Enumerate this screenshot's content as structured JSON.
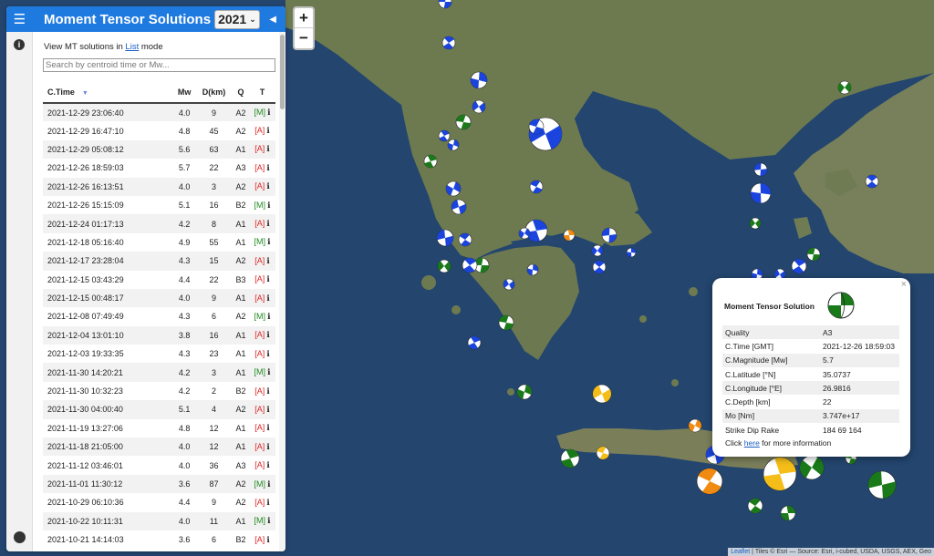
{
  "sidebar": {
    "title": "Moment Tensor Solutions",
    "year": "2021",
    "mode_prefix": "View MT solutions in ",
    "mode_link": "List",
    "mode_suffix": " mode",
    "search_placeholder": "Search by centroid time or Mw...",
    "columns": {
      "time": "C.Time",
      "mw": "Mw",
      "depth": "D(km)",
      "q": "Q",
      "t": "T"
    },
    "rows": [
      {
        "time": "2021-12-29 23:06:40",
        "mw": "4.0",
        "depth": "9",
        "q": "A2",
        "t": "[M]"
      },
      {
        "time": "2021-12-29 16:47:10",
        "mw": "4.8",
        "depth": "45",
        "q": "A2",
        "t": "[A]"
      },
      {
        "time": "2021-12-29 05:08:12",
        "mw": "5.6",
        "depth": "63",
        "q": "A1",
        "t": "[A]"
      },
      {
        "time": "2021-12-26 18:59:03",
        "mw": "5.7",
        "depth": "22",
        "q": "A3",
        "t": "[A]"
      },
      {
        "time": "2021-12-26 16:13:51",
        "mw": "4.0",
        "depth": "3",
        "q": "A2",
        "t": "[A]"
      },
      {
        "time": "2021-12-26 15:15:09",
        "mw": "5.1",
        "depth": "16",
        "q": "B2",
        "t": "[M]"
      },
      {
        "time": "2021-12-24 01:17:13",
        "mw": "4.2",
        "depth": "8",
        "q": "A1",
        "t": "[A]"
      },
      {
        "time": "2021-12-18 05:16:40",
        "mw": "4.9",
        "depth": "55",
        "q": "A1",
        "t": "[M]"
      },
      {
        "time": "2021-12-17 23:28:04",
        "mw": "4.3",
        "depth": "15",
        "q": "A2",
        "t": "[A]"
      },
      {
        "time": "2021-12-15 03:43:29",
        "mw": "4.4",
        "depth": "22",
        "q": "B3",
        "t": "[A]"
      },
      {
        "time": "2021-12-15 00:48:17",
        "mw": "4.0",
        "depth": "9",
        "q": "A1",
        "t": "[A]"
      },
      {
        "time": "2021-12-08 07:49:49",
        "mw": "4.3",
        "depth": "6",
        "q": "A2",
        "t": "[M]"
      },
      {
        "time": "2021-12-04 13:01:10",
        "mw": "3.8",
        "depth": "16",
        "q": "A1",
        "t": "[A]"
      },
      {
        "time": "2021-12-03 19:33:35",
        "mw": "4.3",
        "depth": "23",
        "q": "A1",
        "t": "[A]"
      },
      {
        "time": "2021-11-30 14:20:21",
        "mw": "4.2",
        "depth": "3",
        "q": "A1",
        "t": "[M]"
      },
      {
        "time": "2021-11-30 10:32:23",
        "mw": "4.2",
        "depth": "2",
        "q": "B2",
        "t": "[A]"
      },
      {
        "time": "2021-11-30 04:00:40",
        "mw": "5.1",
        "depth": "4",
        "q": "A2",
        "t": "[A]"
      },
      {
        "time": "2021-11-19 13:27:06",
        "mw": "4.8",
        "depth": "12",
        "q": "A1",
        "t": "[A]"
      },
      {
        "time": "2021-11-18 21:05:00",
        "mw": "4.0",
        "depth": "12",
        "q": "A1",
        "t": "[A]"
      },
      {
        "time": "2021-11-12 03:46:01",
        "mw": "4.0",
        "depth": "36",
        "q": "A3",
        "t": "[A]"
      },
      {
        "time": "2021-11-01 11:30:12",
        "mw": "3.6",
        "depth": "87",
        "q": "A2",
        "t": "[M]"
      },
      {
        "time": "2021-10-29 06:10:36",
        "mw": "4.4",
        "depth": "9",
        "q": "A2",
        "t": "[A]"
      },
      {
        "time": "2021-10-22 10:11:31",
        "mw": "4.0",
        "depth": "11",
        "q": "A1",
        "t": "[M]"
      },
      {
        "time": "2021-10-21 14:14:03",
        "mw": "3.6",
        "depth": "6",
        "q": "B2",
        "t": "[A]"
      }
    ]
  },
  "zoom": {
    "in": "+",
    "out": "−"
  },
  "popup": {
    "title": "Moment Tensor Solution",
    "close": "×",
    "rows": [
      {
        "label": "Quality",
        "value": "A3"
      },
      {
        "label": "C.Time [GMT]",
        "value": "2021-12-26 18:59:03"
      },
      {
        "label": "C.Magnitude [Mw]",
        "value": "5.7"
      },
      {
        "label": "C.Latitude [°N]",
        "value": "35.0737"
      },
      {
        "label": "C.Longitude [°E]",
        "value": "26.9816"
      },
      {
        "label": "C.Depth [km]",
        "value": "22"
      },
      {
        "label": "Mo [Nm]",
        "value": "3.747e+17"
      },
      {
        "label": "Strike Dip Rake",
        "value": "184 69 164"
      }
    ],
    "more_prefix": "Click ",
    "more_link": "here",
    "more_suffix": " for more information"
  },
  "attribution": {
    "leaflet": "Leaflet",
    "text": " | Tiles © Esri — Source: Esri, i-cubed, USDA, USGS, AEX, Geo"
  },
  "colors": {
    "header": "#1f7ae0",
    "sea": "#23456e",
    "land": "#6f7a52",
    "beach_blue": "#1a44dd",
    "beach_green": "#1a7a1a",
    "beach_orange": "#f08a10",
    "beach_yellow": "#f5bd18"
  },
  "icons": {
    "menu": "hamburger-icon",
    "collapse": "caret-left-icon",
    "info": "info-icon",
    "github": "github-icon",
    "sort": "sort-desc-icon"
  }
}
